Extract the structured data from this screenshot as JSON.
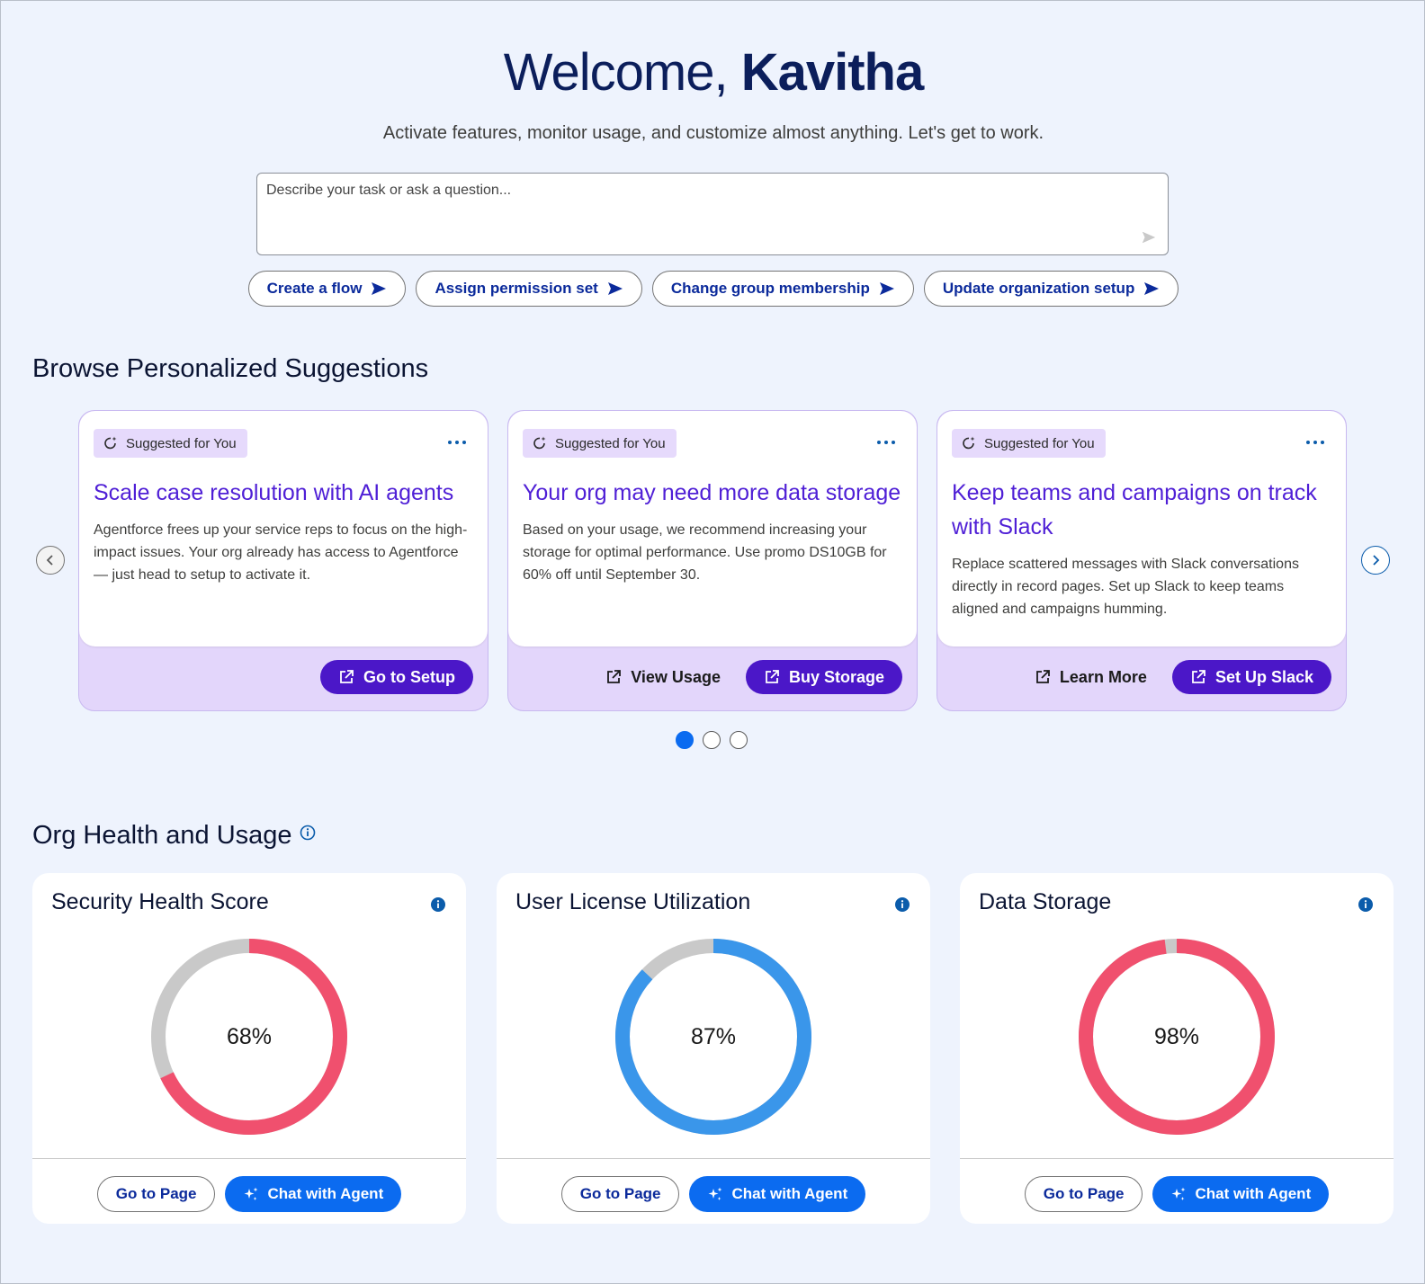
{
  "header": {
    "greeting": "Welcome,",
    "user_name": "Kavitha",
    "subtitle": "Activate features, monitor usage, and customize almost anything. Let's get to work."
  },
  "ask": {
    "placeholder": "Describe your task or ask a question..."
  },
  "quick_actions": [
    {
      "label": "Create a flow"
    },
    {
      "label": "Assign permission set"
    },
    {
      "label": "Change group membership"
    },
    {
      "label": "Update organization setup"
    }
  ],
  "suggestions": {
    "title": "Browse Personalized Suggestions",
    "badge": "Suggested for You",
    "cards": [
      {
        "title": "Scale case resolution with AI agents",
        "description": "Agentforce frees up your service reps to focus on the high-impact issues. Your org already has access to Agentforce — just head to setup to activate it.",
        "primary": "Go to Setup"
      },
      {
        "title": "Your org may need more data storage",
        "description": "Based on your usage, we recommend increasing your storage for optimal performance. Use promo DS10GB for 60% off until September 30.",
        "secondary": "View Usage",
        "primary": "Buy Storage"
      },
      {
        "title": "Keep teams and campaigns on track with Slack",
        "description": "Replace scattered messages with Slack conversations directly in record pages. Set up Slack to keep teams aligned and campaigns humming.",
        "secondary": "Learn More",
        "primary": "Set Up Slack"
      }
    ],
    "page_count": 3,
    "active_page": 1
  },
  "health": {
    "title": "Org Health and Usage",
    "go_label": "Go to Page",
    "agent_label": "Chat with Agent",
    "cards": [
      {
        "title": "Security Health Score",
        "value": "68%",
        "percent": 68,
        "color": "#f0506e"
      },
      {
        "title": "User License Utilization",
        "value": "87%",
        "percent": 87,
        "color": "#3a96ea"
      },
      {
        "title": "Data Storage",
        "value": "98%",
        "percent": 98,
        "color": "#f0506e"
      }
    ],
    "track_color": "#c9c9c9"
  }
}
